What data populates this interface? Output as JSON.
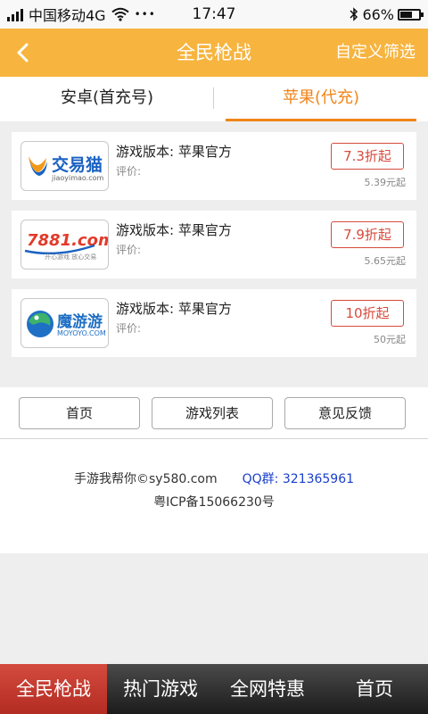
{
  "status_bar": {
    "carrier": "中国移动4G",
    "dots": "•••",
    "time": "17:47",
    "battery_text": "66%",
    "battery_level": 0.66
  },
  "header": {
    "title": "全民枪战",
    "action_label": "自定义筛选"
  },
  "tabs": [
    {
      "label": "安卓(首充号)",
      "active": false
    },
    {
      "label": "苹果(代充)",
      "active": true
    }
  ],
  "items": [
    {
      "logo_text": "交易猫",
      "logo_sub": "jiaoyimao.com",
      "version_label": "游戏版本:  苹果官方",
      "rating_label": "评价:",
      "discount": "7.3折起",
      "price": "5.39元起"
    },
    {
      "logo_text": "7881.com",
      "logo_sub": "开心游戏  放心交易",
      "version_label": "游戏版本:  苹果官方",
      "rating_label": "评价:",
      "discount": "7.9折起",
      "price": "5.65元起"
    },
    {
      "logo_text": "魔游游",
      "logo_sub": "MOYOYO.COM",
      "version_label": "游戏版本:  苹果官方",
      "rating_label": "评价:",
      "discount": "10折起",
      "price": "50元起"
    }
  ],
  "nav_buttons": [
    "首页",
    "游戏列表",
    "意见反馈"
  ],
  "footer": {
    "site": "手游我帮你©sy580.com",
    "qq": "QQ群:  321365961",
    "icp": "粤ICP备15066230号"
  },
  "tabbar": [
    {
      "label": "全民枪战",
      "active": true
    },
    {
      "label": "热门游戏",
      "active": false
    },
    {
      "label": "全网特惠",
      "active": false
    },
    {
      "label": "首页",
      "active": false
    }
  ],
  "colors": {
    "header_bg": "#f7b43f",
    "tab_active": "#f08519",
    "discount_red": "#d64a3b",
    "qq_blue": "#1a3fc9",
    "tabbar_active": "#c23a30"
  }
}
